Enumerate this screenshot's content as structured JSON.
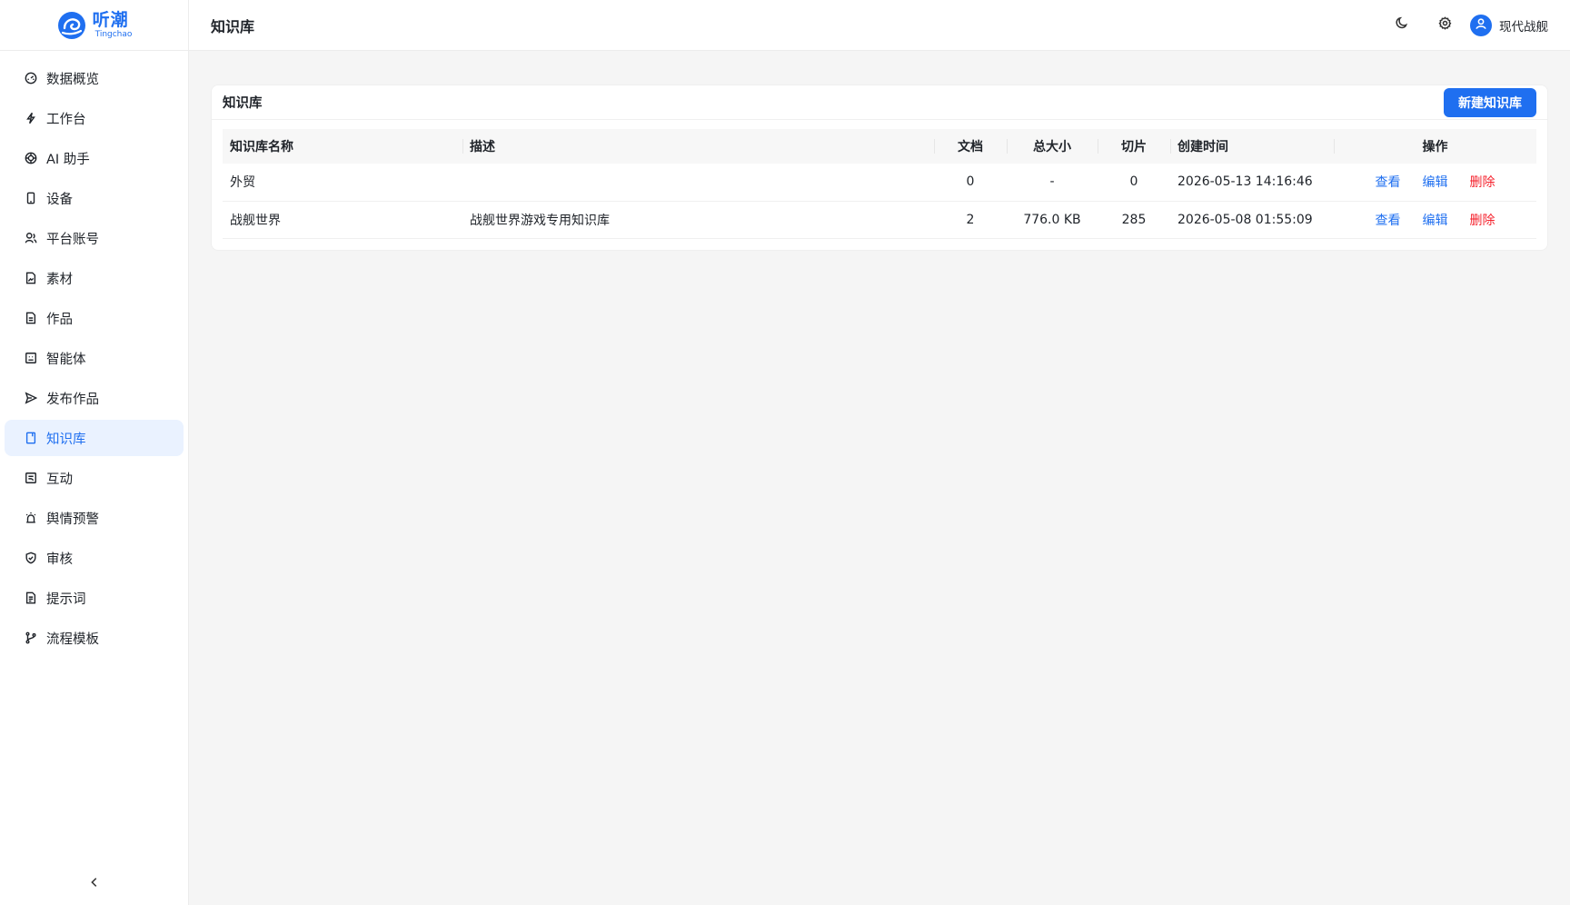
{
  "brand": {
    "name_cn": "听潮",
    "name_en": "Tingchao",
    "color": "#1f6ff0"
  },
  "sidebar": {
    "items": [
      {
        "label": "数据概览",
        "icon": "dashboard-icon"
      },
      {
        "label": "工作台",
        "icon": "lightning-icon"
      },
      {
        "label": "AI 助手",
        "icon": "ai-icon"
      },
      {
        "label": "设备",
        "icon": "phone-icon"
      },
      {
        "label": "平台账号",
        "icon": "user-accounts-icon"
      },
      {
        "label": "素材",
        "icon": "file-image-icon"
      },
      {
        "label": "作品",
        "icon": "file-text-icon"
      },
      {
        "label": "智能体",
        "icon": "bot-icon"
      },
      {
        "label": "发布作品",
        "icon": "send-icon"
      },
      {
        "label": "知识库",
        "icon": "book-icon",
        "active": true
      },
      {
        "label": "互动",
        "icon": "chat-box-icon"
      },
      {
        "label": "舆情预警",
        "icon": "alarm-icon"
      },
      {
        "label": "审核",
        "icon": "shield-check-icon"
      },
      {
        "label": "提示词",
        "icon": "file-prompt-icon"
      },
      {
        "label": "流程模板",
        "icon": "git-branch-icon"
      }
    ]
  },
  "header": {
    "title": "知识库",
    "user_name": "现代战舰"
  },
  "card": {
    "title": "知识库",
    "new_button": "新建知识库",
    "columns": [
      "知识库名称",
      "描述",
      "文档",
      "总大小",
      "切片",
      "创建时间",
      "操作"
    ],
    "rows": [
      {
        "name": "外贸",
        "desc": "",
        "docs": "0",
        "size": "-",
        "chunks": "0",
        "created": "2026-05-13 14:16:46"
      },
      {
        "name": "战舰世界",
        "desc": "战舰世界游戏专用知识库",
        "docs": "2",
        "size": "776.0 KB",
        "chunks": "285",
        "created": "2026-05-08 01:55:09"
      }
    ],
    "actions": {
      "view": "查看",
      "edit": "编辑",
      "delete": "删除"
    }
  }
}
